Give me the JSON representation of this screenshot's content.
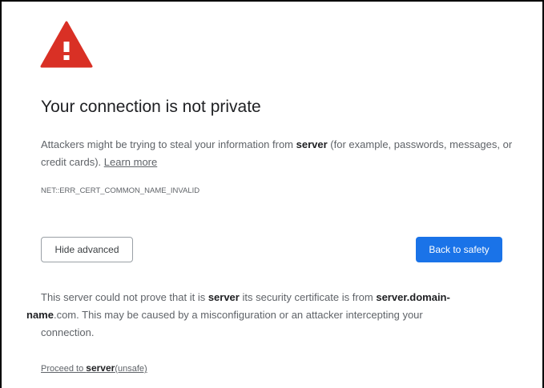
{
  "icon": "warning-triangle-icon",
  "colors": {
    "warning": "#d93025",
    "primary": "#1a73e8",
    "text": "#202124",
    "muted": "#5f6368"
  },
  "title": "Your connection is not private",
  "description": {
    "part1": "Attackers might be trying to steal your information from ",
    "host": "server",
    "part2": "  (for example, passwords, messages, or credit cards). ",
    "learn_more": "Learn more"
  },
  "error_code": "NET::ERR_CERT_COMMON_NAME_INVALID",
  "buttons": {
    "hide_advanced": "Hide advanced",
    "back_to_safety": "Back to safety"
  },
  "details": {
    "part1": "This server could not prove that it is ",
    "host": "server",
    "part2": "  its security certificate is from ",
    "cert_host_a": "server.domain-",
    "cert_host_b": "name",
    "part3": ".com. This may be caused by a misconfiguration or an attacker intercepting your",
    "part4": "connection."
  },
  "proceed": {
    "prefix": "Proceed to ",
    "host": "server",
    "suffix": "(unsafe)"
  }
}
